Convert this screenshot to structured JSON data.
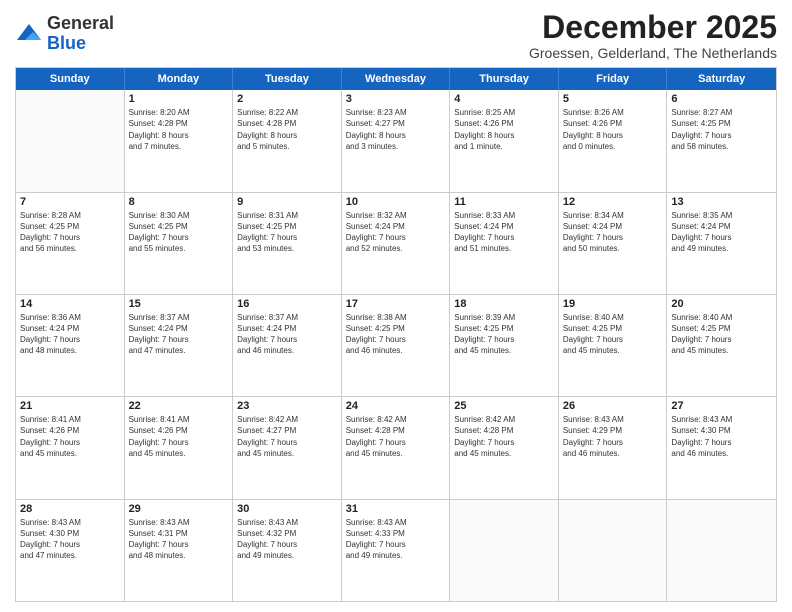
{
  "logo": {
    "general": "General",
    "blue": "Blue"
  },
  "title": "December 2025",
  "location": "Groessen, Gelderland, The Netherlands",
  "days_of_week": [
    "Sunday",
    "Monday",
    "Tuesday",
    "Wednesday",
    "Thursday",
    "Friday",
    "Saturday"
  ],
  "weeks": [
    [
      {
        "day": "",
        "info": ""
      },
      {
        "day": "1",
        "info": "Sunrise: 8:20 AM\nSunset: 4:28 PM\nDaylight: 8 hours\nand 7 minutes."
      },
      {
        "day": "2",
        "info": "Sunrise: 8:22 AM\nSunset: 4:28 PM\nDaylight: 8 hours\nand 5 minutes."
      },
      {
        "day": "3",
        "info": "Sunrise: 8:23 AM\nSunset: 4:27 PM\nDaylight: 8 hours\nand 3 minutes."
      },
      {
        "day": "4",
        "info": "Sunrise: 8:25 AM\nSunset: 4:26 PM\nDaylight: 8 hours\nand 1 minute."
      },
      {
        "day": "5",
        "info": "Sunrise: 8:26 AM\nSunset: 4:26 PM\nDaylight: 8 hours\nand 0 minutes."
      },
      {
        "day": "6",
        "info": "Sunrise: 8:27 AM\nSunset: 4:25 PM\nDaylight: 7 hours\nand 58 minutes."
      }
    ],
    [
      {
        "day": "7",
        "info": "Sunrise: 8:28 AM\nSunset: 4:25 PM\nDaylight: 7 hours\nand 56 minutes."
      },
      {
        "day": "8",
        "info": "Sunrise: 8:30 AM\nSunset: 4:25 PM\nDaylight: 7 hours\nand 55 minutes."
      },
      {
        "day": "9",
        "info": "Sunrise: 8:31 AM\nSunset: 4:25 PM\nDaylight: 7 hours\nand 53 minutes."
      },
      {
        "day": "10",
        "info": "Sunrise: 8:32 AM\nSunset: 4:24 PM\nDaylight: 7 hours\nand 52 minutes."
      },
      {
        "day": "11",
        "info": "Sunrise: 8:33 AM\nSunset: 4:24 PM\nDaylight: 7 hours\nand 51 minutes."
      },
      {
        "day": "12",
        "info": "Sunrise: 8:34 AM\nSunset: 4:24 PM\nDaylight: 7 hours\nand 50 minutes."
      },
      {
        "day": "13",
        "info": "Sunrise: 8:35 AM\nSunset: 4:24 PM\nDaylight: 7 hours\nand 49 minutes."
      }
    ],
    [
      {
        "day": "14",
        "info": "Sunrise: 8:36 AM\nSunset: 4:24 PM\nDaylight: 7 hours\nand 48 minutes."
      },
      {
        "day": "15",
        "info": "Sunrise: 8:37 AM\nSunset: 4:24 PM\nDaylight: 7 hours\nand 47 minutes."
      },
      {
        "day": "16",
        "info": "Sunrise: 8:37 AM\nSunset: 4:24 PM\nDaylight: 7 hours\nand 46 minutes."
      },
      {
        "day": "17",
        "info": "Sunrise: 8:38 AM\nSunset: 4:25 PM\nDaylight: 7 hours\nand 46 minutes."
      },
      {
        "day": "18",
        "info": "Sunrise: 8:39 AM\nSunset: 4:25 PM\nDaylight: 7 hours\nand 45 minutes."
      },
      {
        "day": "19",
        "info": "Sunrise: 8:40 AM\nSunset: 4:25 PM\nDaylight: 7 hours\nand 45 minutes."
      },
      {
        "day": "20",
        "info": "Sunrise: 8:40 AM\nSunset: 4:25 PM\nDaylight: 7 hours\nand 45 minutes."
      }
    ],
    [
      {
        "day": "21",
        "info": "Sunrise: 8:41 AM\nSunset: 4:26 PM\nDaylight: 7 hours\nand 45 minutes."
      },
      {
        "day": "22",
        "info": "Sunrise: 8:41 AM\nSunset: 4:26 PM\nDaylight: 7 hours\nand 45 minutes."
      },
      {
        "day": "23",
        "info": "Sunrise: 8:42 AM\nSunset: 4:27 PM\nDaylight: 7 hours\nand 45 minutes."
      },
      {
        "day": "24",
        "info": "Sunrise: 8:42 AM\nSunset: 4:28 PM\nDaylight: 7 hours\nand 45 minutes."
      },
      {
        "day": "25",
        "info": "Sunrise: 8:42 AM\nSunset: 4:28 PM\nDaylight: 7 hours\nand 45 minutes."
      },
      {
        "day": "26",
        "info": "Sunrise: 8:43 AM\nSunset: 4:29 PM\nDaylight: 7 hours\nand 46 minutes."
      },
      {
        "day": "27",
        "info": "Sunrise: 8:43 AM\nSunset: 4:30 PM\nDaylight: 7 hours\nand 46 minutes."
      }
    ],
    [
      {
        "day": "28",
        "info": "Sunrise: 8:43 AM\nSunset: 4:30 PM\nDaylight: 7 hours\nand 47 minutes."
      },
      {
        "day": "29",
        "info": "Sunrise: 8:43 AM\nSunset: 4:31 PM\nDaylight: 7 hours\nand 48 minutes."
      },
      {
        "day": "30",
        "info": "Sunrise: 8:43 AM\nSunset: 4:32 PM\nDaylight: 7 hours\nand 49 minutes."
      },
      {
        "day": "31",
        "info": "Sunrise: 8:43 AM\nSunset: 4:33 PM\nDaylight: 7 hours\nand 49 minutes."
      },
      {
        "day": "",
        "info": ""
      },
      {
        "day": "",
        "info": ""
      },
      {
        "day": "",
        "info": ""
      }
    ]
  ]
}
